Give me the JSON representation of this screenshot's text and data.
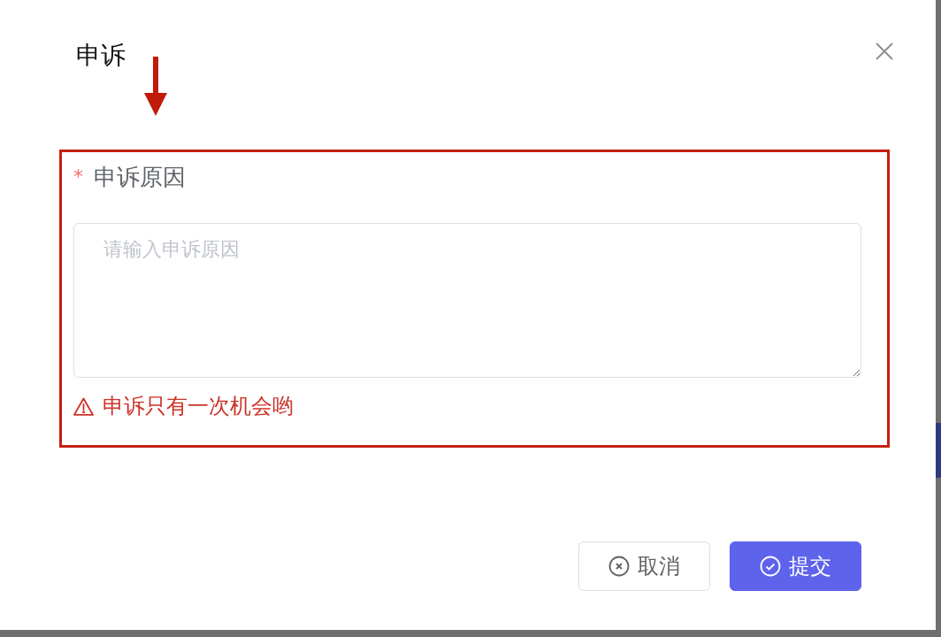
{
  "dialog": {
    "title": "申诉",
    "form": {
      "required_mark": "*",
      "label": "申诉原因",
      "placeholder": "请输入申诉原因",
      "warning": "申诉只有一次机会哟"
    },
    "buttons": [
      {
        "label": "取消",
        "kind": "cancel"
      },
      {
        "label": "提交",
        "kind": "submit"
      }
    ]
  }
}
